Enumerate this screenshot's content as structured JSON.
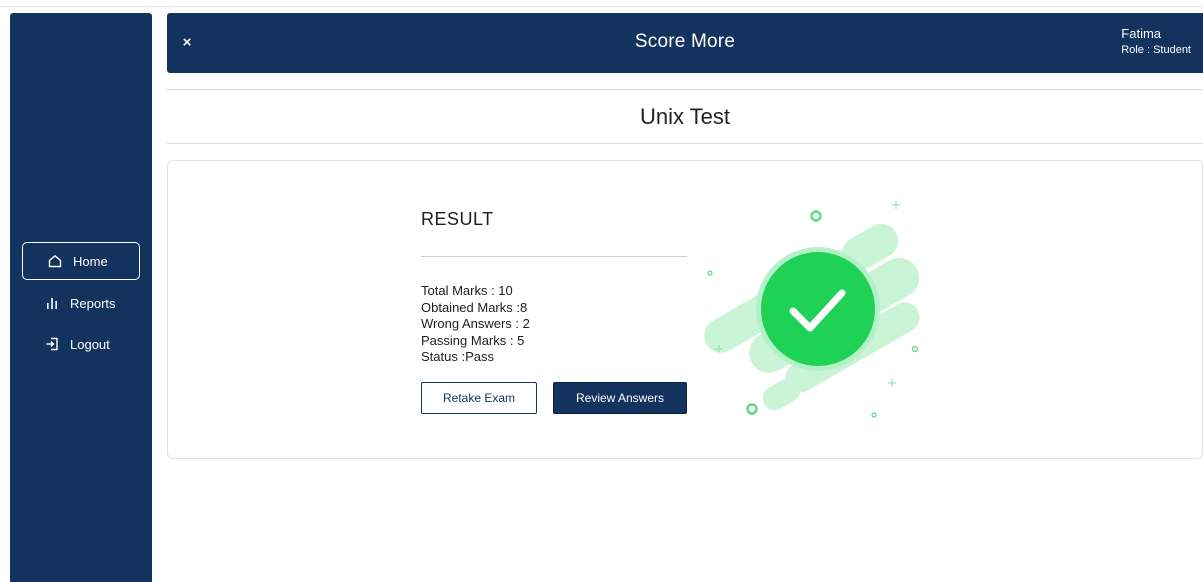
{
  "header": {
    "close_label": "×",
    "title": "Score More",
    "user_name": "Fatima",
    "user_role": "Role : Student"
  },
  "sidebar": {
    "items": [
      {
        "label": "Home",
        "icon": "home-icon",
        "active": true
      },
      {
        "label": "Reports",
        "icon": "bar-chart-icon",
        "active": false
      },
      {
        "label": "Logout",
        "icon": "logout-icon",
        "active": false
      }
    ]
  },
  "page": {
    "title": "Unix Test"
  },
  "result": {
    "heading": "RESULT",
    "stats": [
      {
        "label": "Total Marks : ",
        "value": "10"
      },
      {
        "label": "Obtained Marks :",
        "value": "8"
      },
      {
        "label": "Wrong Answers : ",
        "value": "2"
      },
      {
        "label": "Passing Marks : ",
        "value": "5"
      },
      {
        "label": "Status :",
        "value": "Pass"
      }
    ],
    "retake_label": "Retake Exam",
    "review_label": "Review Answers"
  },
  "colors": {
    "navy": "#13335e",
    "success_green": "#1fd155",
    "light_green": "#c9f5d6"
  },
  "icons": {
    "success": "check-circle-icon"
  }
}
